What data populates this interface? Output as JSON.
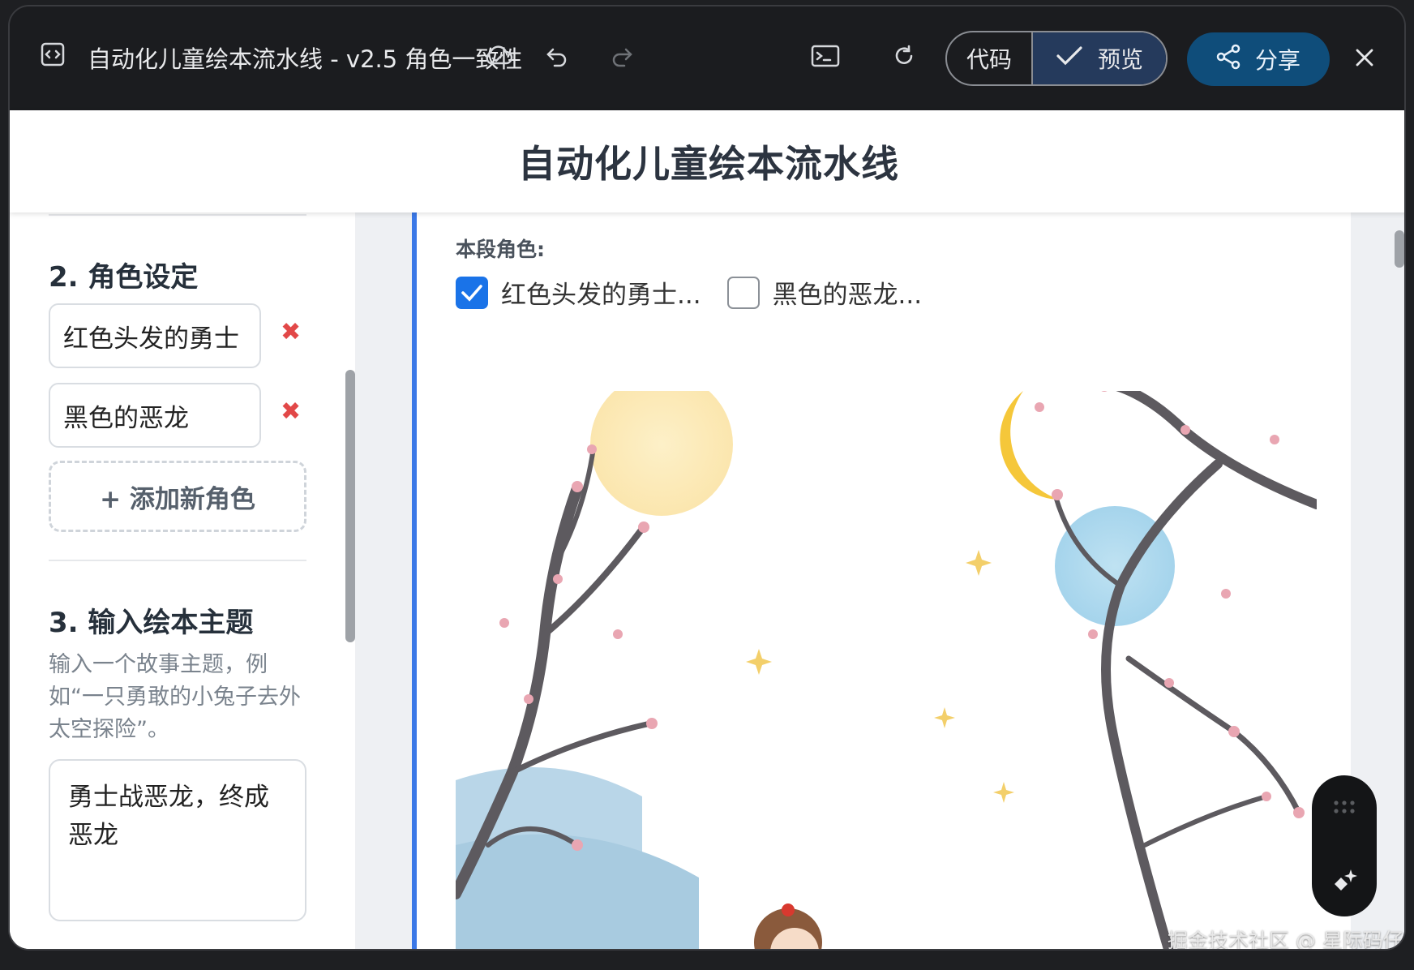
{
  "toolbar": {
    "title": "自动化儿童绘本流水线 - v2.5 角色一致性",
    "code_label": "代码",
    "preview_label": "预览",
    "share_label": "分享"
  },
  "app": {
    "title": "自动化儿童绘本流水线"
  },
  "sidebar": {
    "section2_heading": "2. 角色设定",
    "characters": [
      {
        "name": "红色头发的勇士"
      },
      {
        "name": "黑色的恶龙"
      }
    ],
    "delete_glyph": "✖",
    "add_character_label": "+ 添加新角色",
    "section3_heading": "3. 输入绘本主题",
    "theme_hint": "输入一个故事主题，例如“一只勇敢的小兔子去外太空探险”。",
    "theme_value": "勇士战恶龙，终成恶龙"
  },
  "segment": {
    "characters_label": "本段角色:",
    "options": [
      {
        "label": "红色头发的勇士...",
        "checked": true
      },
      {
        "label": "黑色的恶龙...",
        "checked": false
      }
    ]
  },
  "watermark": "掘金技术社区 @ 星际码仔",
  "colors": {
    "accent_blue": "#1a73e8",
    "card_border": "#3b78e7",
    "share_bg": "#0f4d7a",
    "delete_red": "#e24848"
  },
  "icons": [
    "code-window-icon",
    "cloud-sync-icon",
    "undo-icon",
    "redo-icon",
    "terminal-icon",
    "refresh-icon",
    "check-icon",
    "share-icon",
    "close-icon",
    "grid-dots-icon",
    "sparkle-icon"
  ]
}
